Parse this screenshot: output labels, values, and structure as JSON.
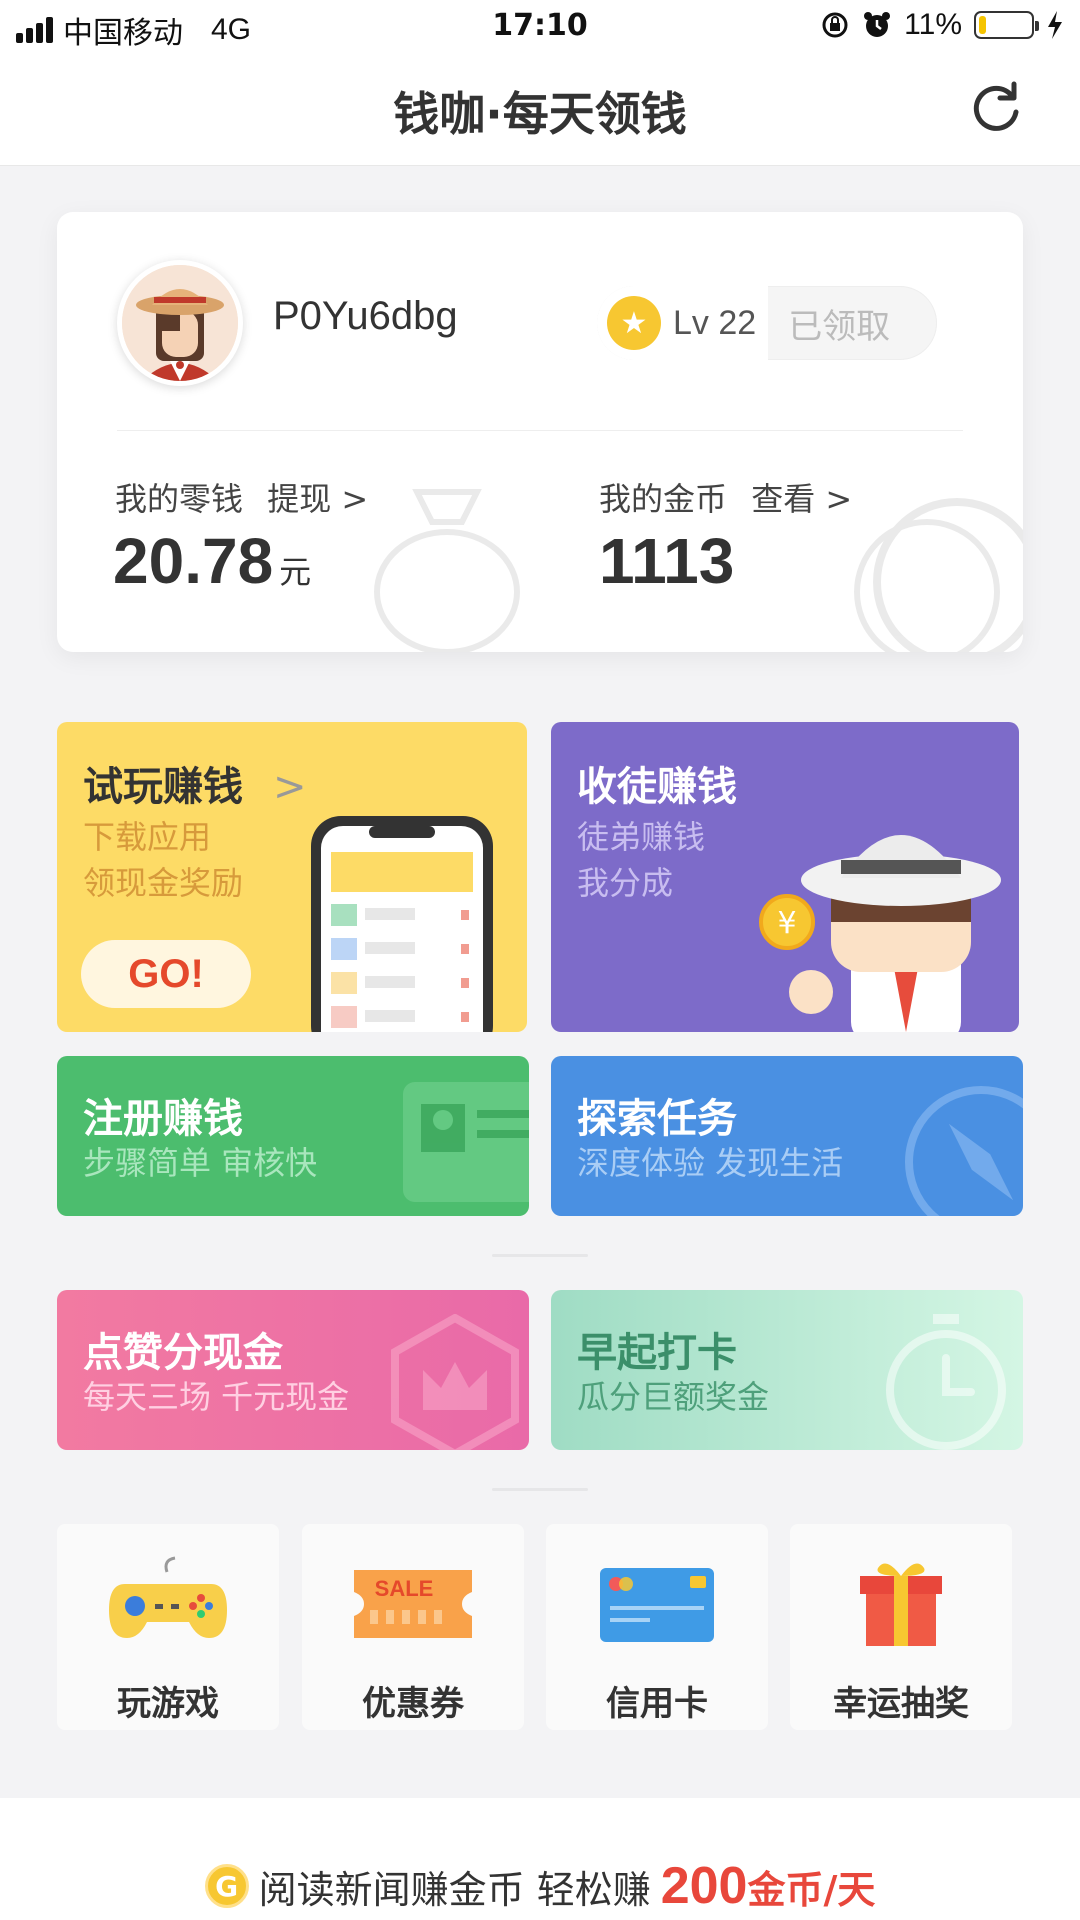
{
  "status_bar": {
    "carrier": "中国移动",
    "network": "4G",
    "time": "17:10",
    "battery": "11%"
  },
  "header": {
    "title": "钱咖·每天领钱"
  },
  "profile": {
    "username": "P0Yu6dbg",
    "level": "Lv 22",
    "claim_status": "已领取",
    "change_label": "我的零钱",
    "change_action": "提现 >",
    "change_value": "20.78",
    "change_unit": "元",
    "coins_label": "我的金币",
    "coins_action": "查看 >",
    "coins_value": "1113"
  },
  "tiles": {
    "trial": {
      "title": "试玩赚钱",
      "arrow": ">",
      "line1": "下载应用",
      "line2": "领现金奖励",
      "button": "GO!"
    },
    "recruit": {
      "title": "收徒赚钱",
      "line1": "徒弟赚钱",
      "line2": "我分成"
    },
    "register": {
      "title": "注册赚钱",
      "subtitle": "步骤简单 审核快"
    },
    "explore": {
      "title": "探索任务",
      "subtitle": "深度体验 发现生活"
    },
    "like": {
      "title": "点赞分现金",
      "subtitle": "每天三场 千元现金"
    },
    "morning": {
      "title": "早起打卡",
      "subtitle": "瓜分巨额奖金"
    }
  },
  "shortcuts": [
    {
      "label": "玩游戏",
      "icon": "gamepad-icon"
    },
    {
      "label": "优惠券",
      "icon": "coupon-icon",
      "icon_text": "SALE"
    },
    {
      "label": "信用卡",
      "icon": "credit-card-icon"
    },
    {
      "label": "幸运抽奖",
      "icon": "gift-icon"
    }
  ],
  "banner": {
    "coin_letter": "G",
    "text": "阅读新闻赚金币 轻松赚",
    "amount": "200",
    "unit": "金币/天"
  },
  "colors": {
    "trial": "#fddb66",
    "recruit": "#7d6bc9",
    "register": "#4cbd6e",
    "explore": "#4a90e2",
    "like": "#ee6a9a",
    "morning": "#b7ead2",
    "accent_red": "#e8473b"
  }
}
